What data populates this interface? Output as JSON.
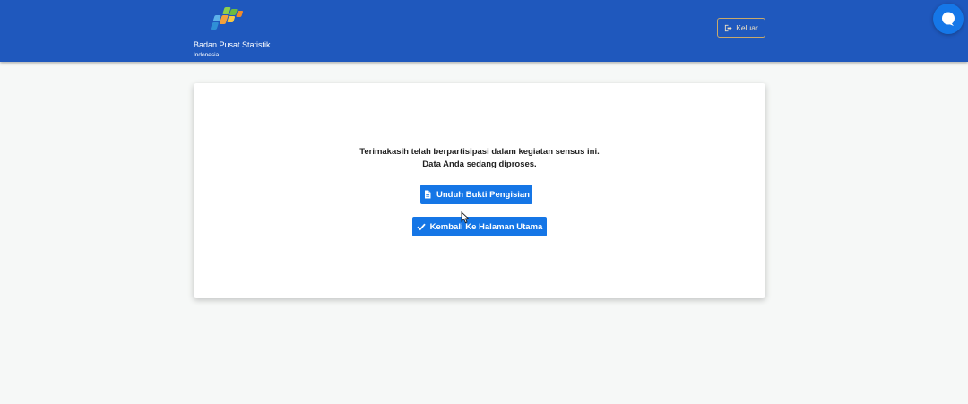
{
  "header": {
    "org_name": "Badan Pusat Statistik",
    "country": "Indonesia",
    "logout_label": "Keluar"
  },
  "icons": {
    "logo": "bps-logo-icon",
    "logout": "sign-out-icon",
    "chat": "chat-bubble-icon",
    "download": "file-icon",
    "home": "check-icon"
  },
  "colors": {
    "header_bg": "#1f58bd",
    "button_bg": "#1576e6",
    "logout_border": "#c9a96a",
    "page_bg": "#f6f8f7"
  },
  "card": {
    "message_line1": "Terimakasih telah berpartisipasi dalam kegiatan sensus ini.",
    "message_line2": "Data Anda sedang diproses.",
    "download_label": "Unduh Bukti Pengisian",
    "home_label": "Kembali Ke Halaman Utama"
  }
}
